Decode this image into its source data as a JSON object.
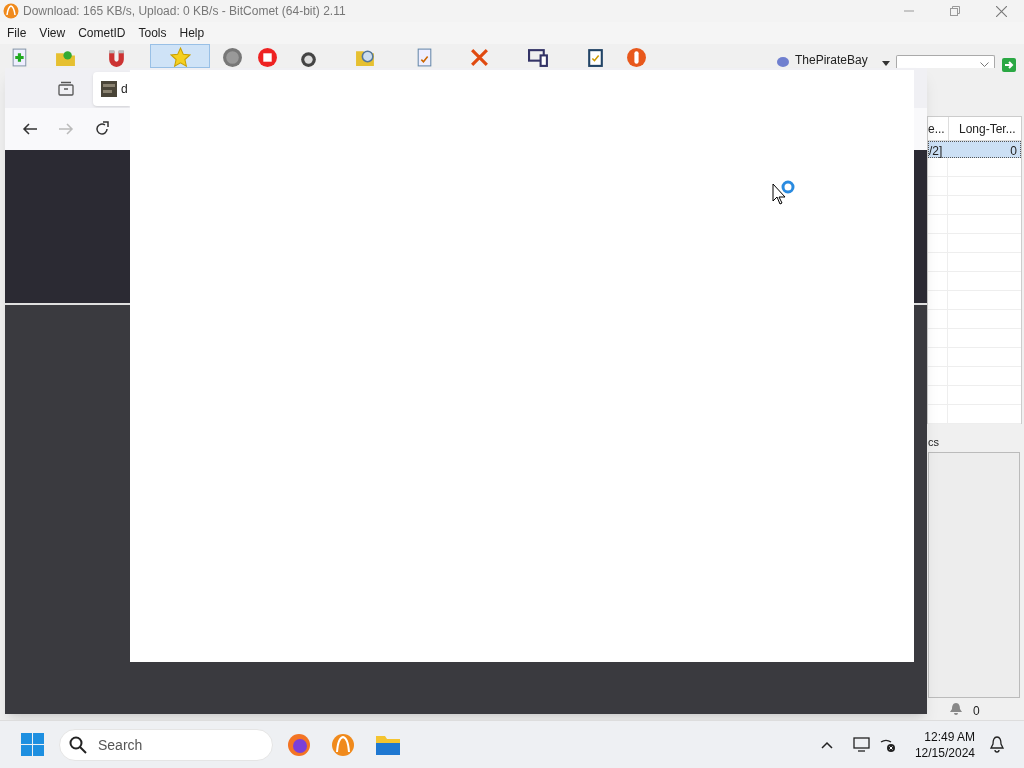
{
  "bitcomet": {
    "title": "Download: 165 KB/s, Upload: 0 KB/s - BitComet (64-bit) 2.11",
    "menu": [
      "File",
      "View",
      "CometID",
      "Tools",
      "Help"
    ],
    "search_site": "ThePirateBay",
    "table": {
      "columns": [
        "e...",
        "Long-Ter..."
      ],
      "rows": [
        {
          "cells": [
            "/2]",
            "0"
          ],
          "selected": true
        }
      ]
    },
    "panel_tab": "cs",
    "status_count": "0"
  },
  "browser": {
    "tab_title": "d"
  },
  "taskbar": {
    "search_placeholder": "Search",
    "time": "12:49 AM",
    "date": "12/15/2024"
  }
}
